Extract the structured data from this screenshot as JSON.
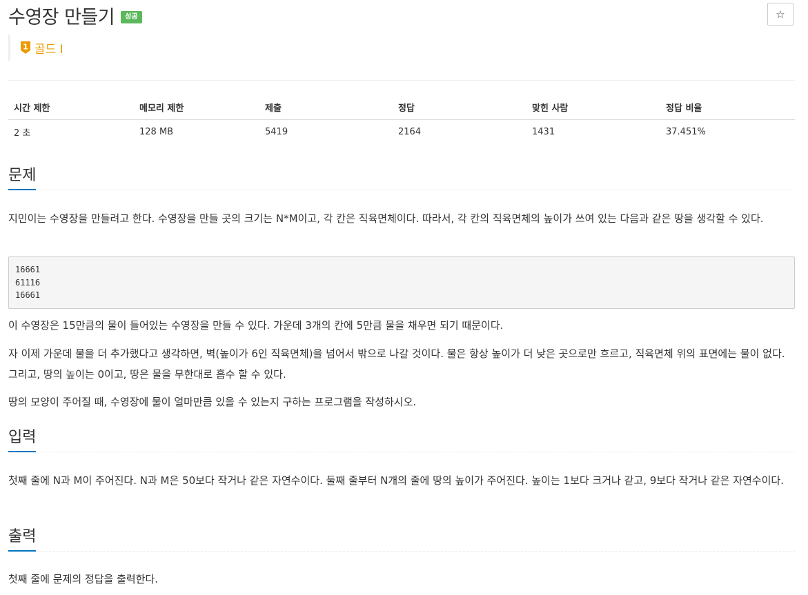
{
  "problem": {
    "title": "수영장 만들기",
    "status_badge": "성공",
    "star_label": "☆",
    "tier": {
      "level": "1",
      "label": "골드 I",
      "color": "#ec9a00"
    }
  },
  "info_table": {
    "headers": [
      "시간 제한",
      "메모리 제한",
      "제출",
      "정답",
      "맞힌 사람",
      "정답 비율"
    ],
    "values": [
      "2 초",
      "128 MB",
      "5419",
      "2164",
      "1431",
      "37.451%"
    ]
  },
  "sections": {
    "problem": {
      "heading": "문제",
      "p1": "지민이는 수영장을 만들려고 한다. 수영장을 만들 곳의 크기는 N*M이고, 각 칸은 직육면체이다. 따라서, 각 칸의 직육면체의 높이가 쓰여 있는 다음과 같은 땅을 생각할 수 있다.",
      "example_lines": [
        "16661",
        "61116",
        "16661"
      ],
      "p2": "이 수영장은 15만큼의 물이 들어있는 수영장을 만들 수 있다. 가운데 3개의 칸에 5만큼 물을 채우면 되기 때문이다.",
      "p3": "자 이제 가운데 물을 더 추가했다고 생각하면, 벽(높이가 6인 직육면체)을 넘어서 밖으로 나갈 것이다. 물은 항상 높이가 더 낮은 곳으로만 흐르고, 직육면체 위의 표면에는 물이 없다. 그리고, 땅의 높이는 0이고, 땅은 물을 무한대로 흡수 할 수 있다.",
      "p4": "땅의 모양이 주어질 때, 수영장에 물이 얼마만큼 있을 수 있는지 구하는 프로그램을 작성하시오."
    },
    "input": {
      "heading": "입력",
      "text": "첫째 줄에 N과 M이 주어진다. N과 M은 50보다 작거나 같은 자연수이다. 둘째 줄부터 N개의 줄에 땅의 높이가 주어진다. 높이는 1보다 크거나 같고, 9보다 작거나 같은 자연수이다."
    },
    "output": {
      "heading": "출력",
      "text": "첫째 줄에 문제의 정답을 출력한다."
    }
  }
}
